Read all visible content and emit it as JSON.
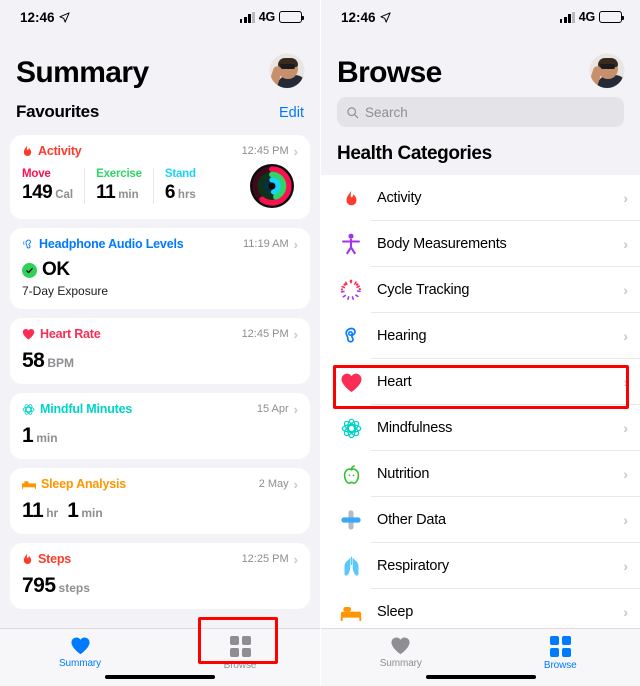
{
  "status_bar": {
    "time": "12:46",
    "network": "4G",
    "location_icon": "location-arrow-icon",
    "signal_icon": "cellular-bars-icon",
    "battery_icon": "battery-icon"
  },
  "colors": {
    "accent_blue": "#007aff",
    "activity_red": "#fc3c2d",
    "move_red": "#fa114f",
    "exercise_green": "#2fd566",
    "stand_cyan": "#1ad3f7",
    "heart_pink": "#fc2d55",
    "mindful_teal": "#00d4c8",
    "sleep_orange": "#ff9500",
    "headphone_blue": "#007aff",
    "ok_green": "#30d158",
    "highlight_red": "#ff0000",
    "nutrition_green": "#30c030",
    "body_purple": "#a033f0",
    "respiratory_blue": "#5ac8fa"
  },
  "summary_screen": {
    "title": "Summary",
    "avatar": "user-avatar",
    "section": {
      "title": "Favourites",
      "edit_label": "Edit"
    },
    "cards": [
      {
        "id": "activity",
        "title": "Activity",
        "icon": "flame-icon",
        "icon_color": "#fc3c2d",
        "title_color": "#fc3c2d",
        "time": "12:45 PM",
        "type": "activity",
        "rings": "activity-rings",
        "columns": [
          {
            "label": "Move",
            "color": "#fa114f",
            "value": "149",
            "unit": "Cal"
          },
          {
            "label": "Exercise",
            "color": "#2fd566",
            "value": "11",
            "unit": "min"
          },
          {
            "label": "Stand",
            "color": "#1ad3f7",
            "value": "6",
            "unit": "hrs"
          }
        ]
      },
      {
        "id": "headphone-audio-levels",
        "title": "Headphone Audio Levels",
        "icon": "ear-audio-icon",
        "icon_color": "#007aff",
        "title_color": "#007aff",
        "time": "11:19 AM",
        "type": "status",
        "status_text": "OK",
        "status_icon": "checkmark-circle-icon",
        "subtitle": "7-Day Exposure"
      },
      {
        "id": "heart-rate",
        "title": "Heart Rate",
        "icon": "heart-icon",
        "icon_color": "#fc2d55",
        "title_color": "#fc2d55",
        "time": "12:45 PM",
        "type": "metric",
        "value": "58",
        "unit": "BPM"
      },
      {
        "id": "mindful-minutes",
        "title": "Mindful Minutes",
        "icon": "mindfulness-icon",
        "icon_color": "#00d4c8",
        "title_color": "#00d4c8",
        "time": "15 Apr",
        "type": "metric",
        "value": "1",
        "unit": "min"
      },
      {
        "id": "sleep-analysis",
        "title": "Sleep Analysis",
        "icon": "bed-icon",
        "icon_color": "#ff9500",
        "title_color": "#ff9500",
        "time": "2 May",
        "type": "metric2",
        "value": "11",
        "unit": "hr",
        "value2": "1",
        "unit2": "min"
      },
      {
        "id": "steps",
        "title": "Steps",
        "icon": "flame-icon",
        "icon_color": "#fc3c2d",
        "title_color": "#fc3c2d",
        "time": "12:25 PM",
        "type": "metric",
        "value": "795",
        "unit": "steps"
      }
    ],
    "tabbar": {
      "tabs": [
        {
          "id": "summary",
          "label": "Summary",
          "icon": "heart-icon",
          "active": true
        },
        {
          "id": "browse",
          "label": "Browse",
          "icon": "grid-icon",
          "active": false
        }
      ]
    },
    "highlight": {
      "target": "browse-tab"
    }
  },
  "browse_screen": {
    "title": "Browse",
    "avatar": "user-avatar",
    "search": {
      "placeholder": "Search",
      "icon": "search-icon"
    },
    "section_title": "Health Categories",
    "categories": [
      {
        "id": "activity",
        "label": "Activity",
        "icon": "flame-icon",
        "color": "#fc3c2d"
      },
      {
        "id": "body-measurements",
        "label": "Body Measurements",
        "icon": "body-figure-icon",
        "color": "#a033f0"
      },
      {
        "id": "cycle-tracking",
        "label": "Cycle Tracking",
        "icon": "cycle-tracking-icon",
        "color": "#fc2d55"
      },
      {
        "id": "hearing",
        "label": "Hearing",
        "icon": "ear-icon",
        "color": "#007aff"
      },
      {
        "id": "heart",
        "label": "Heart",
        "icon": "heart-icon",
        "color": "#fc2d55"
      },
      {
        "id": "mindfulness",
        "label": "Mindfulness",
        "icon": "mindfulness-icon",
        "color": "#00d4c8"
      },
      {
        "id": "nutrition",
        "label": "Nutrition",
        "icon": "apple-icon",
        "color": "#30c030"
      },
      {
        "id": "other-data",
        "label": "Other Data",
        "icon": "cross-data-icon",
        "color": "#5ac8fa"
      },
      {
        "id": "respiratory",
        "label": "Respiratory",
        "icon": "lungs-icon",
        "color": "#5ac8fa"
      },
      {
        "id": "sleep",
        "label": "Sleep",
        "icon": "bed-icon",
        "color": "#ff9500"
      }
    ],
    "tabbar": {
      "tabs": [
        {
          "id": "summary",
          "label": "Summary",
          "icon": "heart-icon",
          "active": false
        },
        {
          "id": "browse",
          "label": "Browse",
          "icon": "grid-icon",
          "active": true
        }
      ]
    },
    "highlight": {
      "target": "heart-category-row"
    }
  }
}
